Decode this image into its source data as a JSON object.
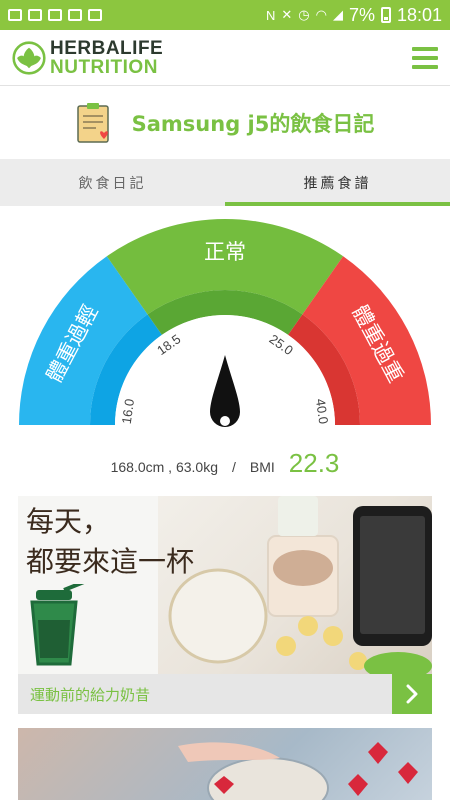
{
  "status_bar": {
    "battery": "7%",
    "time": "18:01"
  },
  "header": {
    "logo_line1": "HERBALIFE",
    "logo_line2": "NUTRITION"
  },
  "page": {
    "title": "Samsung j5的飲食日記"
  },
  "tabs": [
    {
      "label": "飲食日記",
      "active": false
    },
    {
      "label": "推薦食譜",
      "active": true
    }
  ],
  "gauge": {
    "segments": [
      {
        "label": "體重過輕",
        "color": "#29b6ef"
      },
      {
        "label": "正常",
        "color": "#74bd3e"
      },
      {
        "label": "體重過重",
        "color": "#ef4743"
      }
    ],
    "tick_labels": [
      "16.0",
      "18.5",
      "25.0",
      "40.0"
    ],
    "needle_value": 22.3
  },
  "bmi": {
    "measurements": "168.0cm , 63.0kg",
    "separator": "/",
    "label": "BMI",
    "value": "22.3"
  },
  "cards": [
    {
      "slogan_line1": "每天，",
      "slogan_line2": "都要來這一杯",
      "caption": "運動前的給力奶昔"
    }
  ],
  "colors": {
    "brand_green": "#7ac143",
    "status_bar": "#8cc63f"
  }
}
